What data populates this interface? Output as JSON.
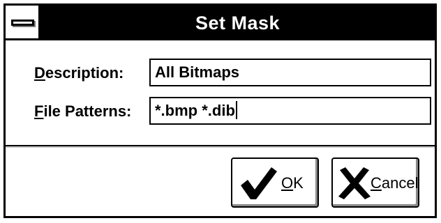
{
  "dialog": {
    "title": "Set Mask",
    "system_menu_icon": "system-menu-bar-icon"
  },
  "form": {
    "description": {
      "label_mnemonic": "D",
      "label_rest": "escription:",
      "value": "All Bitmaps"
    },
    "file_patterns": {
      "label_mnemonic": "F",
      "label_rest": "ile Patterns:",
      "value": "*.bmp *.dib"
    }
  },
  "buttons": {
    "ok": {
      "mnemonic": "O",
      "rest": "K",
      "icon": "checkmark-icon"
    },
    "cancel": {
      "mnemonic": "C",
      "rest": "ancel",
      "icon": "x-mark-icon"
    }
  },
  "colors": {
    "titlebar": "#000000",
    "title_text": "#ffffff",
    "background": "#ffffff",
    "border": "#000000"
  }
}
